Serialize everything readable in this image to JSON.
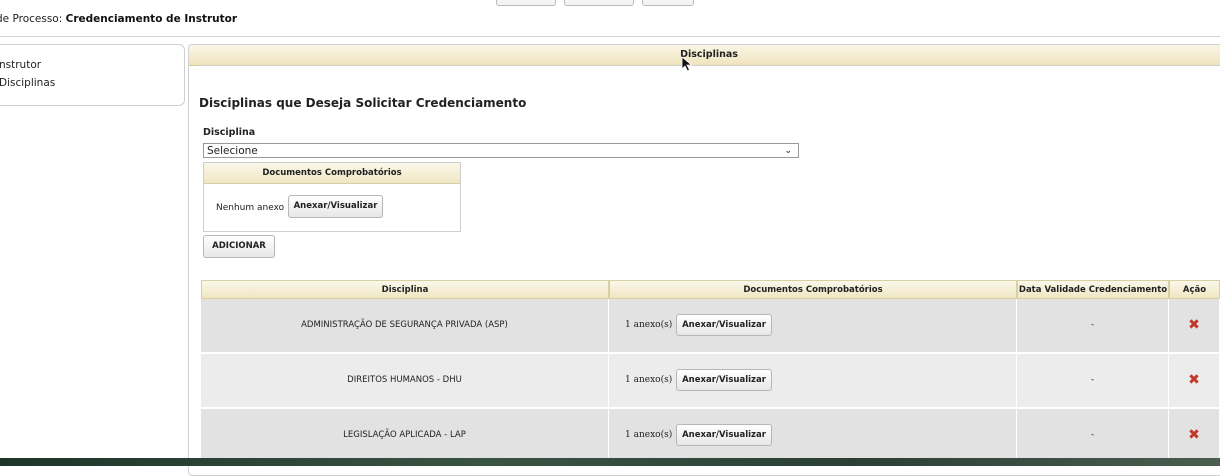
{
  "process": {
    "label": "de Processo:",
    "name": "Credenciamento de Instrutor"
  },
  "sidebar": {
    "items": [
      "nstrutor",
      "Disciplinas"
    ]
  },
  "panel": {
    "title": "Disciplinas"
  },
  "section": {
    "title": "Disciplinas que Deseja Solicitar Credenciamento"
  },
  "form": {
    "disciplina_label": "Disciplina",
    "select_value": "Selecione",
    "docs_title": "Documentos Comprobatórios",
    "no_attachment": "Nenhum anexo",
    "attach_button": "Anexar/Visualizar",
    "add_button": "ADICIONAR"
  },
  "table": {
    "headers": [
      "Disciplina",
      "Documentos Comprobatórios",
      "Data Validade Credenciamento",
      "Ação"
    ],
    "rows": [
      {
        "disciplina": "ADMINISTRAÇÃO DE SEGURANÇA PRIVADA (ASP)",
        "anexos": "1 anexo(s)",
        "botao": "Anexar/Visualizar",
        "validade": "-"
      },
      {
        "disciplina": "DIREITOS HUMANOS - DHU",
        "anexos": "1 anexo(s)",
        "botao": "Anexar/Visualizar",
        "validade": "-"
      },
      {
        "disciplina": "LEGISLAÇÃO APLICADA - LAP",
        "anexos": "1 anexo(s)",
        "botao": "Anexar/Visualizar",
        "validade": "-"
      }
    ]
  },
  "colors": {
    "header_gold": "#efe6c2",
    "row_alt": "#e2e2e2",
    "row_plain": "#ececec",
    "delete_red": "#c0392b"
  },
  "icons": {
    "delete": "delete-x-icon",
    "dropdown": "chevron-down-icon",
    "cursor": "mouse-pointer-icon"
  }
}
